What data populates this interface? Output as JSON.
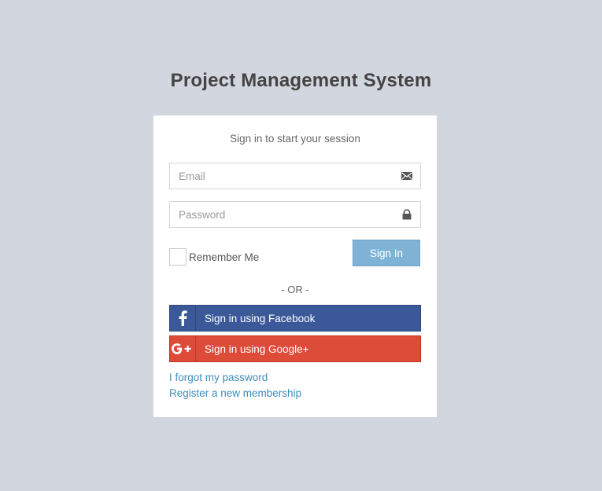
{
  "page": {
    "title": "Project Management System",
    "background_color": "#d2d6de"
  },
  "login_box": {
    "subtitle": "Sign in to start your session",
    "email": {
      "placeholder": "Email",
      "value": "",
      "icon": "envelope-icon"
    },
    "password": {
      "placeholder": "Password",
      "value": "",
      "icon": "lock-icon"
    },
    "remember_me_label": "Remember Me",
    "remember_me_checked": false,
    "signin_label": "Sign In",
    "signin_color": "#7fb3d5",
    "or_divider": "- OR -",
    "facebook": {
      "label": "Sign in using Facebook",
      "icon": "facebook-icon",
      "color": "#3b5998"
    },
    "google": {
      "label": "Sign in using Google+",
      "icon": "google-plus-icon",
      "color": "#dd4b39"
    },
    "forgot_password_link": "I forgot my password",
    "register_link": "Register a new membership",
    "link_color": "#3c8dbc"
  }
}
